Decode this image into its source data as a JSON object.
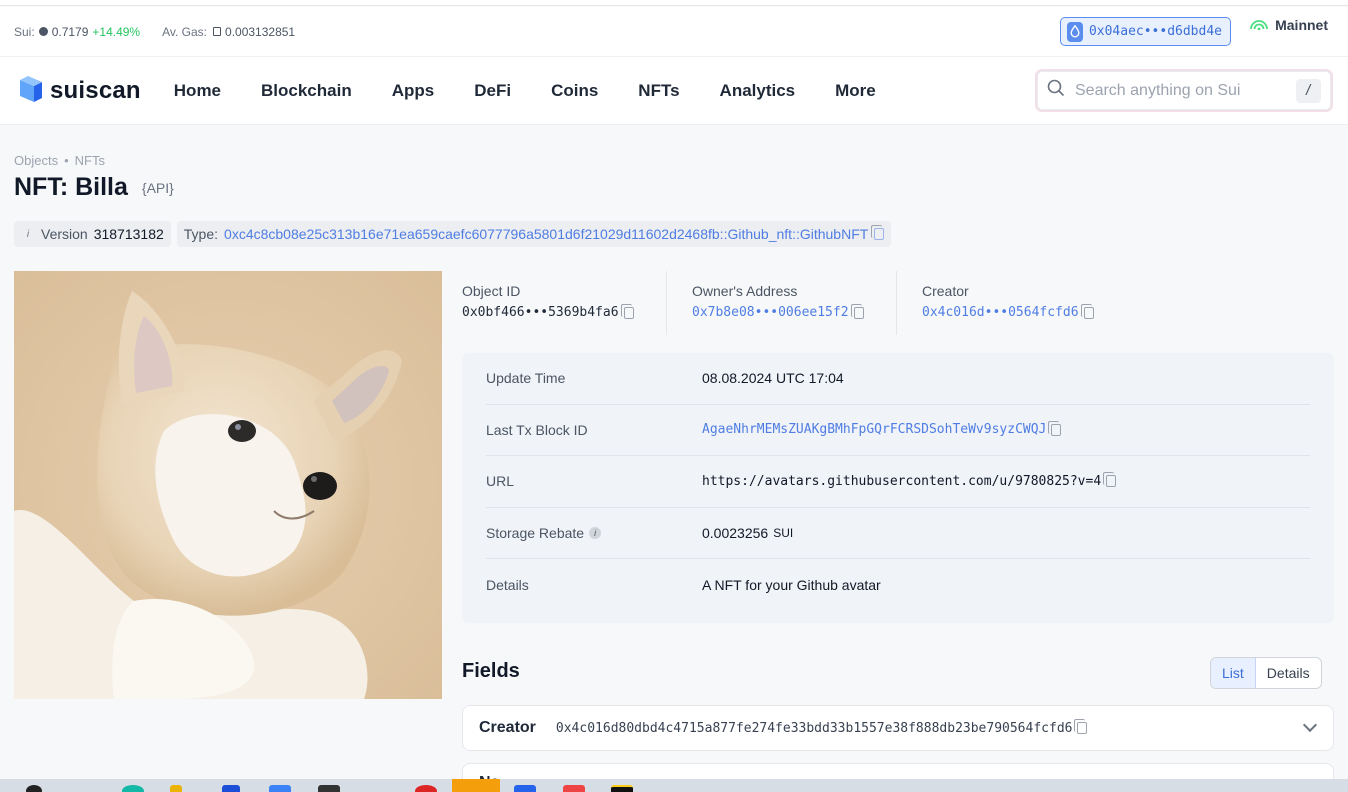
{
  "infobar": {
    "sui_label": "Sui:",
    "sui_price": "0.7179",
    "sui_change": "+14.49%",
    "gas_label": "Av. Gas:",
    "gas_value": "0.003132851",
    "wallet": "0x04aec•••d6dbd4e",
    "network": "Mainnet"
  },
  "nav": {
    "logo": "suiscan",
    "items": [
      "Home",
      "Blockchain",
      "Apps",
      "DeFi",
      "Coins",
      "NFTs",
      "Analytics",
      "More"
    ],
    "search_placeholder": "Search anything on Sui",
    "search_shortcut": "/"
  },
  "breadcrumb": [
    "Objects",
    "NFTs"
  ],
  "title": "NFT: Billa",
  "api_tag": "{API}",
  "meta": {
    "version_label": "Version",
    "version_value": "318713182",
    "type_label": "Type:",
    "type_value": "0xc4c8cb08e25c313b16e71ea659caefc6077796a5801d6f21029d11602d2468fb::Github_nft::GithubNFT"
  },
  "summary": {
    "object_id_label": "Object ID",
    "object_id": "0x0bf466•••5369b4fa6",
    "owner_label": "Owner's Address",
    "owner": "0x7b8e08•••006ee15f2",
    "creator_label": "Creator",
    "creator": "0x4c016d•••0564fcfd6"
  },
  "details": {
    "update_time_label": "Update Time",
    "update_time": "08.08.2024 UTC 17:04",
    "last_tx_label": "Last Tx Block ID",
    "last_tx": "AgaeNhrMEMsZUAKgBMhFpGQrFCRSDSohTeWv9syzCWQJ",
    "url_label": "URL",
    "url": "https://avatars.githubusercontent.com/u/9780825?v=4",
    "storage_label": "Storage Rebate",
    "storage_value": "0.0023256",
    "storage_unit": "SUI",
    "details_label": "Details",
    "details_value": "A NFT for your Github avatar"
  },
  "fields": {
    "title": "Fields",
    "toggle": [
      "List",
      "Details"
    ],
    "rows": [
      {
        "name": "Creator",
        "value": "0x4c016d80dbd4c4715a877fe274fe33bdd33b1557e38f888db23be790564fcfd6"
      },
      {
        "name": "Na"
      }
    ]
  },
  "colors": {
    "accent": "#4f7de3",
    "positive": "#22c55e"
  }
}
